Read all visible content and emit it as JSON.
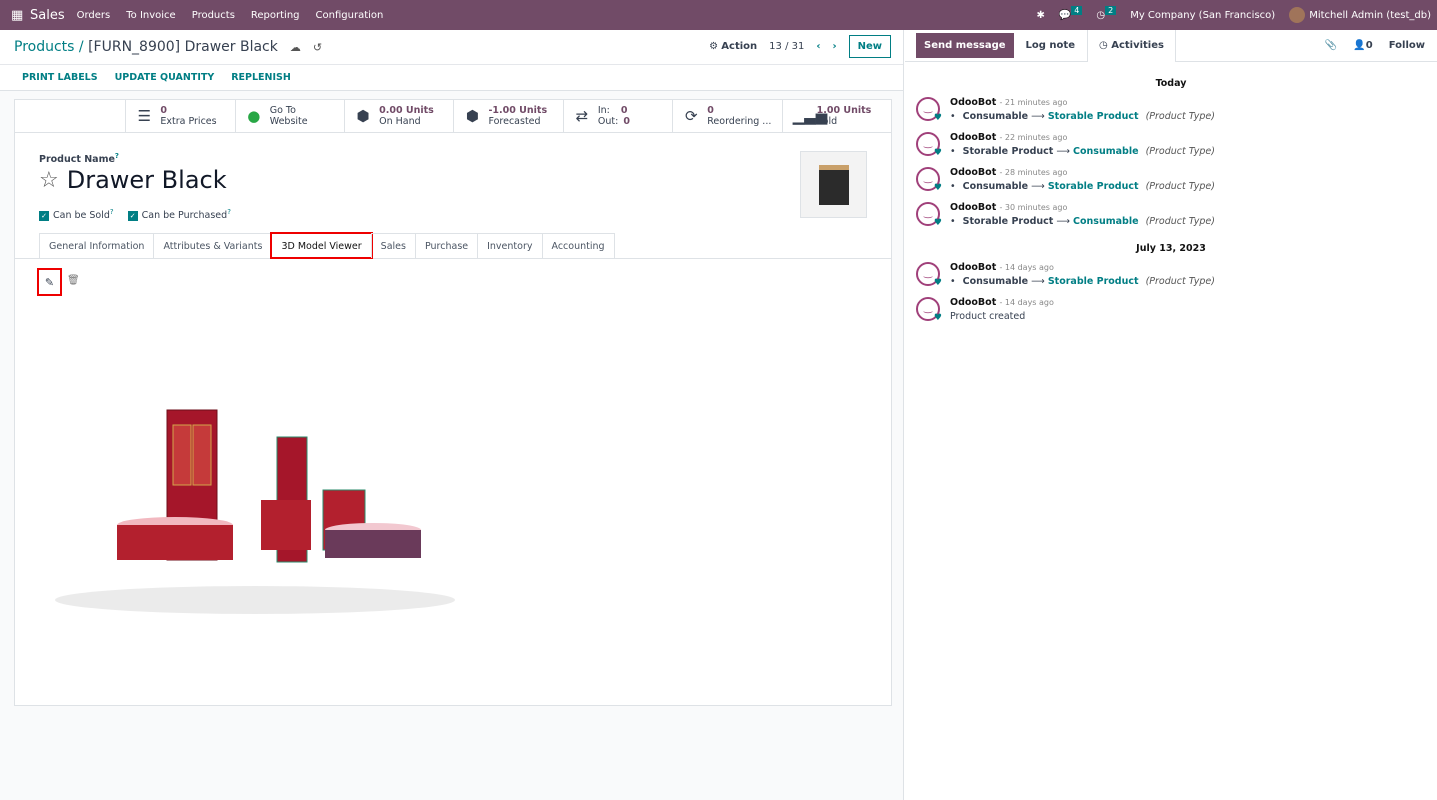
{
  "nav": {
    "app": "Sales",
    "menu": [
      "Orders",
      "To Invoice",
      "Products",
      "Reporting",
      "Configuration"
    ],
    "messages_count": "4",
    "activities_count": "2",
    "company": "My Company (San Francisco)",
    "user": "Mitchell Admin (test_db)"
  },
  "control": {
    "breadcrumb_root": "Products",
    "breadcrumb_current": "[FURN_8900] Drawer Black",
    "action": "Action",
    "pager": "13 / 31",
    "new": "New"
  },
  "buttons": [
    "PRINT LABELS",
    "UPDATE QUANTITY",
    "REPLENISH"
  ],
  "stats": [
    {
      "icon": "list-icon",
      "value": "0",
      "label": "Extra Prices"
    },
    {
      "icon": "globe-icon",
      "value": "Go To",
      "label": "Website"
    },
    {
      "icon": "cubes-icon",
      "value": "0.00 Units",
      "label": "On Hand"
    },
    {
      "icon": "cubes-icon",
      "value": "-1.00 Units",
      "label": "Forecasted"
    },
    {
      "icon": "exchange-icon",
      "in_label": "In:",
      "in_value": "0",
      "out_label": "Out:",
      "out_value": "0"
    },
    {
      "icon": "refresh-icon",
      "value": "0",
      "label": "Reordering ..."
    },
    {
      "icon": "signal-icon",
      "value": "1.00 Units",
      "label": "Sold"
    }
  ],
  "form": {
    "name_label": "Product Name",
    "name": "Drawer Black",
    "can_be_sold": "Can be Sold",
    "can_be_purchased": "Can be Purchased",
    "tooltip": "?"
  },
  "tabs": [
    "General Information",
    "Attributes & Variants",
    "3D Model Viewer",
    "Sales",
    "Purchase",
    "Inventory",
    "Accounting"
  ],
  "active_tab": "3D Model Viewer",
  "chatter": {
    "send": "Send message",
    "log": "Log note",
    "activities": "Activities",
    "followers": "0",
    "follow": "Follow",
    "groups": [
      {
        "date": "Today",
        "messages": [
          {
            "author": "OdooBot",
            "time": "- 21 minutes ago",
            "old": "Consumable",
            "new": "Storable Product",
            "field": "(Product Type)"
          },
          {
            "author": "OdooBot",
            "time": "- 22 minutes ago",
            "old": "Storable Product",
            "new": "Consumable",
            "field": "(Product Type)"
          },
          {
            "author": "OdooBot",
            "time": "- 28 minutes ago",
            "old": "Consumable",
            "new": "Storable Product",
            "field": "(Product Type)"
          },
          {
            "author": "OdooBot",
            "time": "- 30 minutes ago",
            "old": "Storable Product",
            "new": "Consumable",
            "field": "(Product Type)"
          }
        ]
      },
      {
        "date": "July 13, 2023",
        "messages": [
          {
            "author": "OdooBot",
            "time": "- 14 days ago",
            "old": "Consumable",
            "new": "Storable Product",
            "field": "(Product Type)"
          },
          {
            "author": "OdooBot",
            "time": "- 14 days ago",
            "body": "Product created"
          }
        ]
      }
    ]
  },
  "colors": {
    "brand": "#714B67",
    "accent": "#017e84",
    "highlight": "#ee0000"
  }
}
